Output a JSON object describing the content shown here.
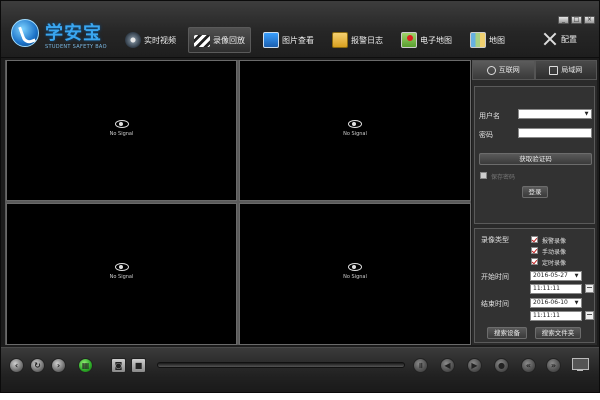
{
  "header": {
    "logo_title": "学安宝",
    "logo_sub": "STUDENT SAFETY BAO",
    "nav": [
      {
        "label": "实时视频",
        "icon": "camera-icon"
      },
      {
        "label": "录像回放",
        "icon": "clapperboard-icon",
        "active": true
      },
      {
        "label": "图片查看",
        "icon": "photo-icon"
      },
      {
        "label": "报警日志",
        "icon": "alarm-log-icon"
      },
      {
        "label": "电子地图",
        "icon": "map-pin-icon"
      },
      {
        "label": "地图",
        "icon": "map-icon"
      }
    ],
    "config_label": "配置",
    "window_buttons": [
      "_",
      "□",
      "×"
    ]
  },
  "video": {
    "no_signal": "No Signal",
    "cells": 4
  },
  "side": {
    "tabs": [
      {
        "label": "互联网",
        "icon": "globe-icon",
        "active": true
      },
      {
        "label": "局域网",
        "icon": "lan-icon"
      }
    ],
    "login": {
      "username_label": "用户名",
      "username_value": "",
      "password_label": "密码",
      "password_value": "",
      "get_code_button": "获取验证码",
      "save_password_label": "保存密码",
      "save_password_checked": false,
      "login_button": "登录"
    },
    "record": {
      "type_label": "录像类型",
      "types": [
        {
          "label": "报警录像",
          "checked": true
        },
        {
          "label": "手动录像",
          "checked": true
        },
        {
          "label": "定时录像",
          "checked": true
        }
      ],
      "start_label": "开始时间",
      "start_date": "2016-05-27",
      "start_time": "11:11:11",
      "end_label": "结束时间",
      "end_date": "2016-06-10",
      "end_time": "11:11:11",
      "search_device_button": "搜索设备",
      "search_file_button": "搜索文件夹"
    }
  },
  "toolbar": {
    "progress": 0.0
  },
  "colors": {
    "background": "#1c1c1c",
    "accent": "#3aa6f0",
    "check": "#c02020"
  }
}
